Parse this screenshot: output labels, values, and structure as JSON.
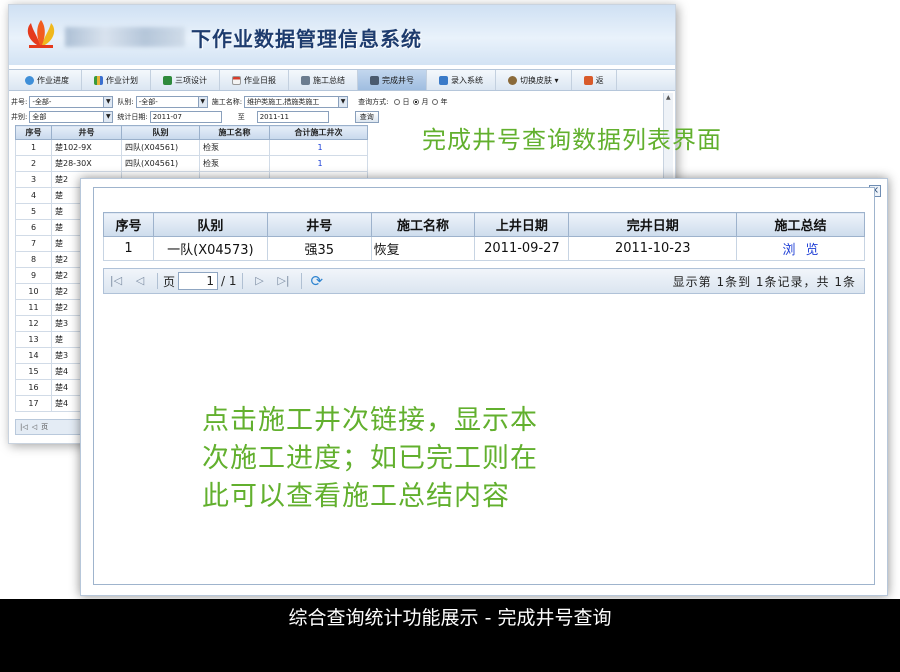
{
  "app": {
    "title": "下作业数据管理信息系统",
    "brand_color": "#1e3c6e"
  },
  "toolbar": {
    "items": [
      {
        "label": "作业进度",
        "icon": "globe-icon"
      },
      {
        "label": "作业计划",
        "icon": "chart-icon"
      },
      {
        "label": "三项设计",
        "icon": "grid-icon"
      },
      {
        "label": "作业日报",
        "icon": "calendar-icon"
      },
      {
        "label": "施工总结",
        "icon": "tools-icon"
      },
      {
        "label": "完成井号",
        "icon": "tools-icon",
        "active": true
      },
      {
        "label": "录入系统",
        "icon": "form-icon"
      },
      {
        "label": "切换皮肤 ▾",
        "icon": "users-icon"
      },
      {
        "label": "返",
        "icon": "home-icon"
      }
    ]
  },
  "filters": {
    "well_label": "井号:",
    "well_value": "-全部-",
    "team_label": "队别:",
    "team_value": "-全部-",
    "construction_label": "施工名称:",
    "construction_value": "维护类施工,措施类施工",
    "query_mode_label": "查询方式:",
    "mode_day": "日",
    "mode_month": "月",
    "mode_year": "年",
    "well_type_label": "井别:",
    "well_type_value": "全部",
    "date_label": "统计日期:",
    "date_from": "2011-07",
    "date_to_label": "至",
    "date_to": "2011-11",
    "query_button": "查询"
  },
  "bg_table": {
    "headers": [
      "序号",
      "井号",
      "队别",
      "施工名称",
      "合计施工井次"
    ],
    "rows": [
      [
        "1",
        "楚102-9X",
        "四队(X04561)",
        "检泵",
        "1"
      ],
      [
        "2",
        "楚28-30X",
        "四队(X04561)",
        "检泵",
        "1"
      ],
      [
        "3",
        "楚2",
        "",
        "",
        ""
      ],
      [
        "4",
        "楚",
        "",
        "",
        ""
      ],
      [
        "5",
        "楚",
        "",
        "",
        ""
      ],
      [
        "6",
        "楚",
        "",
        "",
        ""
      ],
      [
        "7",
        "楚",
        "",
        "",
        ""
      ],
      [
        "8",
        "楚2",
        "",
        "",
        ""
      ],
      [
        "9",
        "楚2",
        "",
        "",
        ""
      ],
      [
        "10",
        "楚2",
        "",
        "",
        ""
      ],
      [
        "11",
        "楚2",
        "",
        "",
        ""
      ],
      [
        "12",
        "楚3",
        "",
        "",
        ""
      ],
      [
        "13",
        "楚",
        "",
        "",
        ""
      ],
      [
        "14",
        "楚3",
        "",
        "",
        ""
      ],
      [
        "15",
        "楚4",
        "",
        "",
        ""
      ],
      [
        "16",
        "楚4",
        "",
        "",
        ""
      ],
      [
        "17",
        "楚4",
        "",
        "",
        ""
      ]
    ],
    "pager_page": "页"
  },
  "callouts": {
    "top": "完成井号查询数据列表界面",
    "middle": "点击施工井次链接，显示本\n次施工进度；如已完工则在\n此可以查看施工总结内容",
    "color": "#62b02e"
  },
  "dialog": {
    "close": "×",
    "headers": [
      "序号",
      "队别",
      "井号",
      "施工名称",
      "上井日期",
      "完井日期",
      "施工总结"
    ],
    "rows": [
      {
        "seq": "1",
        "team": "一队(X04573)",
        "well": "强35",
        "construction": "恢复",
        "start": "2011-09-27",
        "end": "2011-10-23",
        "summary": "浏览"
      }
    ],
    "pager": {
      "page_label": "页",
      "page_value": "1",
      "page_total": "/ 1",
      "info": "显示第 1条到 1条记录，共 1条"
    }
  },
  "footer": {
    "caption": "综合查询统计功能展示 - 完成井号查询"
  }
}
